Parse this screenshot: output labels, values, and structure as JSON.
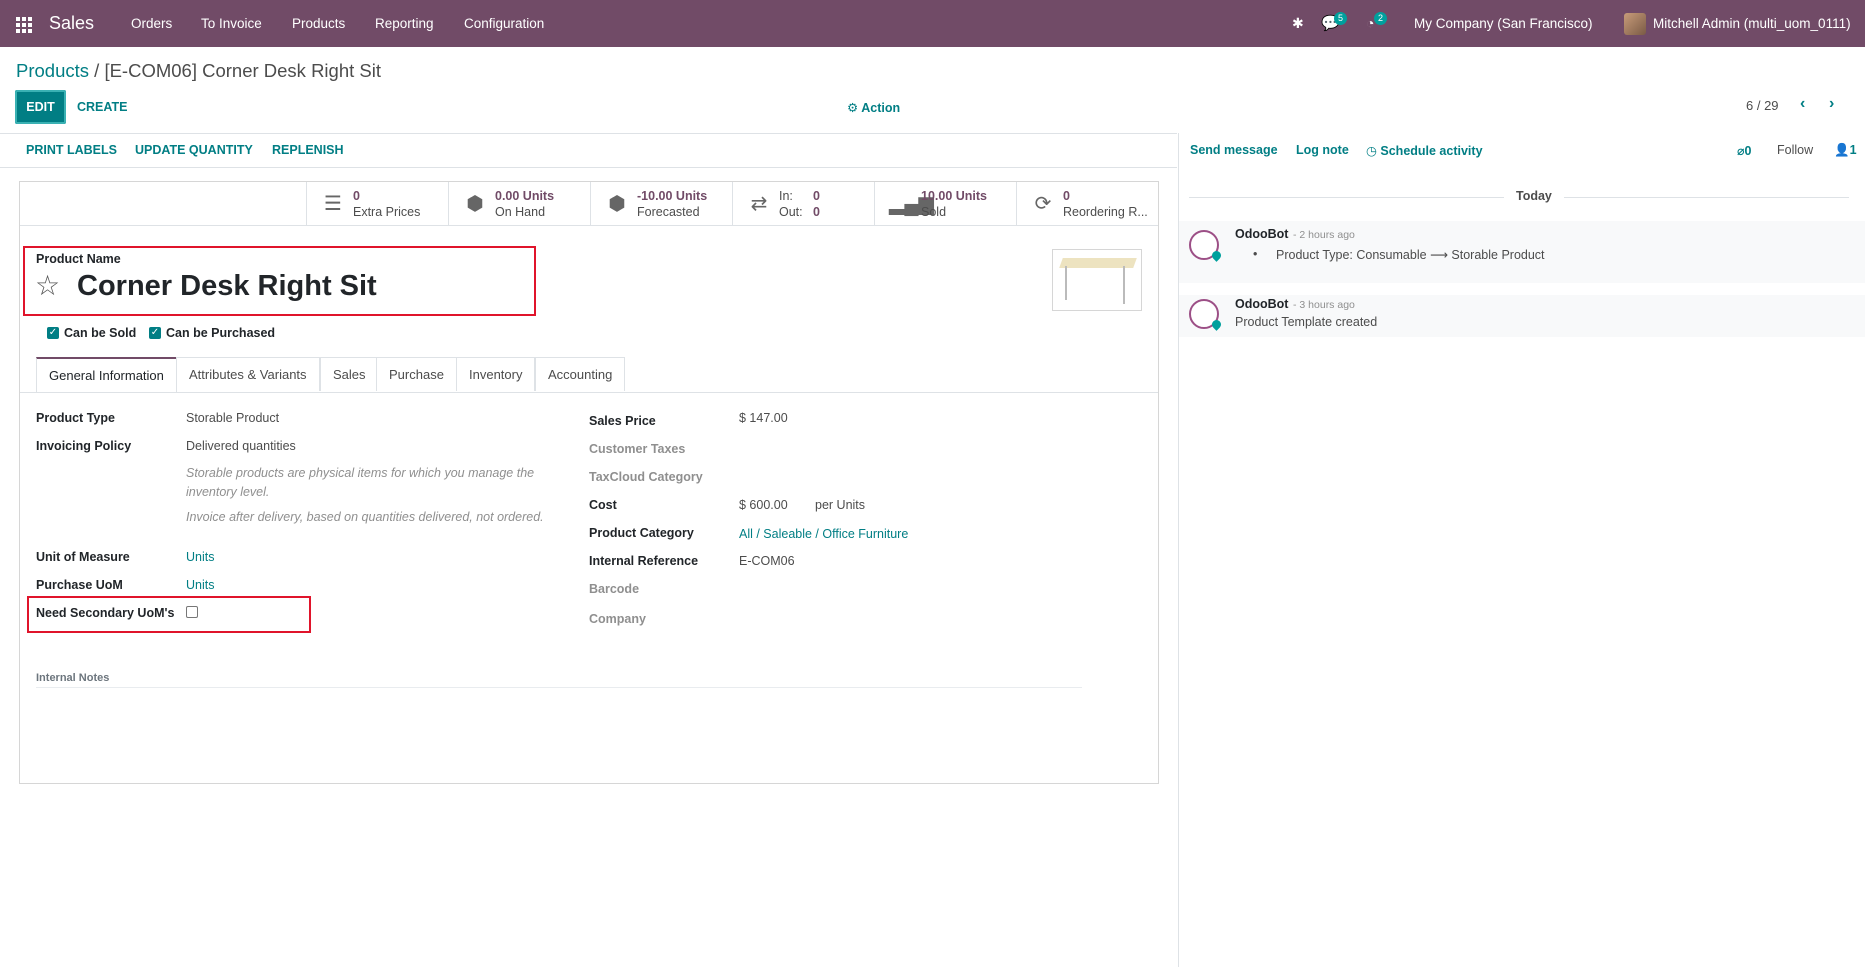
{
  "navbar": {
    "app_name": "Sales",
    "menu": [
      "Orders",
      "To Invoice",
      "Products",
      "Reporting",
      "Configuration"
    ],
    "messages_count": "5",
    "activities_count": "2",
    "company": "My Company (San Francisco)",
    "user": "Mitchell Admin (multi_uom_0111)"
  },
  "breadcrumb": {
    "parent": "Products",
    "separator": "/",
    "current": "[E-COM06] Corner Desk Right Sit"
  },
  "controls": {
    "edit": "EDIT",
    "create": "CREATE",
    "action": "Action",
    "pager": "6 / 29"
  },
  "statusbar": {
    "buttons": [
      "PRINT LABELS",
      "UPDATE QUANTITY",
      "REPLENISH"
    ]
  },
  "smart_buttons": [
    {
      "icon": "list-icon",
      "value": "0",
      "label": "Extra Prices"
    },
    {
      "icon": "cubes-icon",
      "value": "0.00 Units",
      "label": "On Hand"
    },
    {
      "icon": "cubes-icon",
      "value": "-10.00 Units",
      "label": "Forecasted"
    },
    {
      "icon": "exchange-icon",
      "value": "In:",
      "value2": "0",
      "label": "Out:",
      "label2": "0"
    },
    {
      "icon": "signal-icon",
      "value": "10.00 Units",
      "label": "Sold"
    },
    {
      "icon": "refresh-icon",
      "value": "0",
      "label": "Reordering R..."
    }
  ],
  "product": {
    "name_label": "Product Name",
    "name": "Corner Desk Right Sit",
    "can_be_sold": "Can be Sold",
    "can_be_purchased": "Can be Purchased"
  },
  "tabs": [
    "General Information",
    "Attributes & Variants",
    "Sales",
    "Purchase",
    "Inventory",
    "Accounting"
  ],
  "general": {
    "product_type_label": "Product Type",
    "product_type": "Storable Product",
    "invoicing_policy_label": "Invoicing Policy",
    "invoicing_policy": "Delivered quantities",
    "help1": "Storable products are physical items for which you manage the inventory level.",
    "help2": "Invoice after delivery, based on quantities delivered, not ordered.",
    "uom_label": "Unit of Measure",
    "uom": "Units",
    "purchase_uom_label": "Purchase UoM",
    "purchase_uom": "Units",
    "secondary_uom_label": "Need Secondary UoM's",
    "sales_price_label": "Sales Price",
    "sales_price": "$ 147.00",
    "customer_taxes_label": "Customer Taxes",
    "taxcloud_label": "TaxCloud Category",
    "cost_label": "Cost",
    "cost": "$ 600.00",
    "cost_unit": "per Units",
    "category_label": "Product Category",
    "category": "All / Saleable / Office Furniture",
    "internal_ref_label": "Internal Reference",
    "internal_ref": "E-COM06",
    "barcode_label": "Barcode",
    "company_label": "Company",
    "internal_notes_label": "Internal Notes"
  },
  "chatter": {
    "send_message": "Send message",
    "log_note": "Log note",
    "schedule_activity": "Schedule activity",
    "attachments": "0",
    "follow": "Follow",
    "followers": "1",
    "today": "Today",
    "messages": [
      {
        "author": "OdooBot",
        "ago": "- 2 hours ago",
        "text": "Product Type: Consumable ⟶ Storable Product"
      },
      {
        "author": "OdooBot",
        "ago": "- 3 hours ago",
        "text": "Product Template created"
      }
    ]
  },
  "colors": {
    "navbar": "#714b67",
    "accent": "#017e84",
    "highlight": "#e0142b"
  }
}
